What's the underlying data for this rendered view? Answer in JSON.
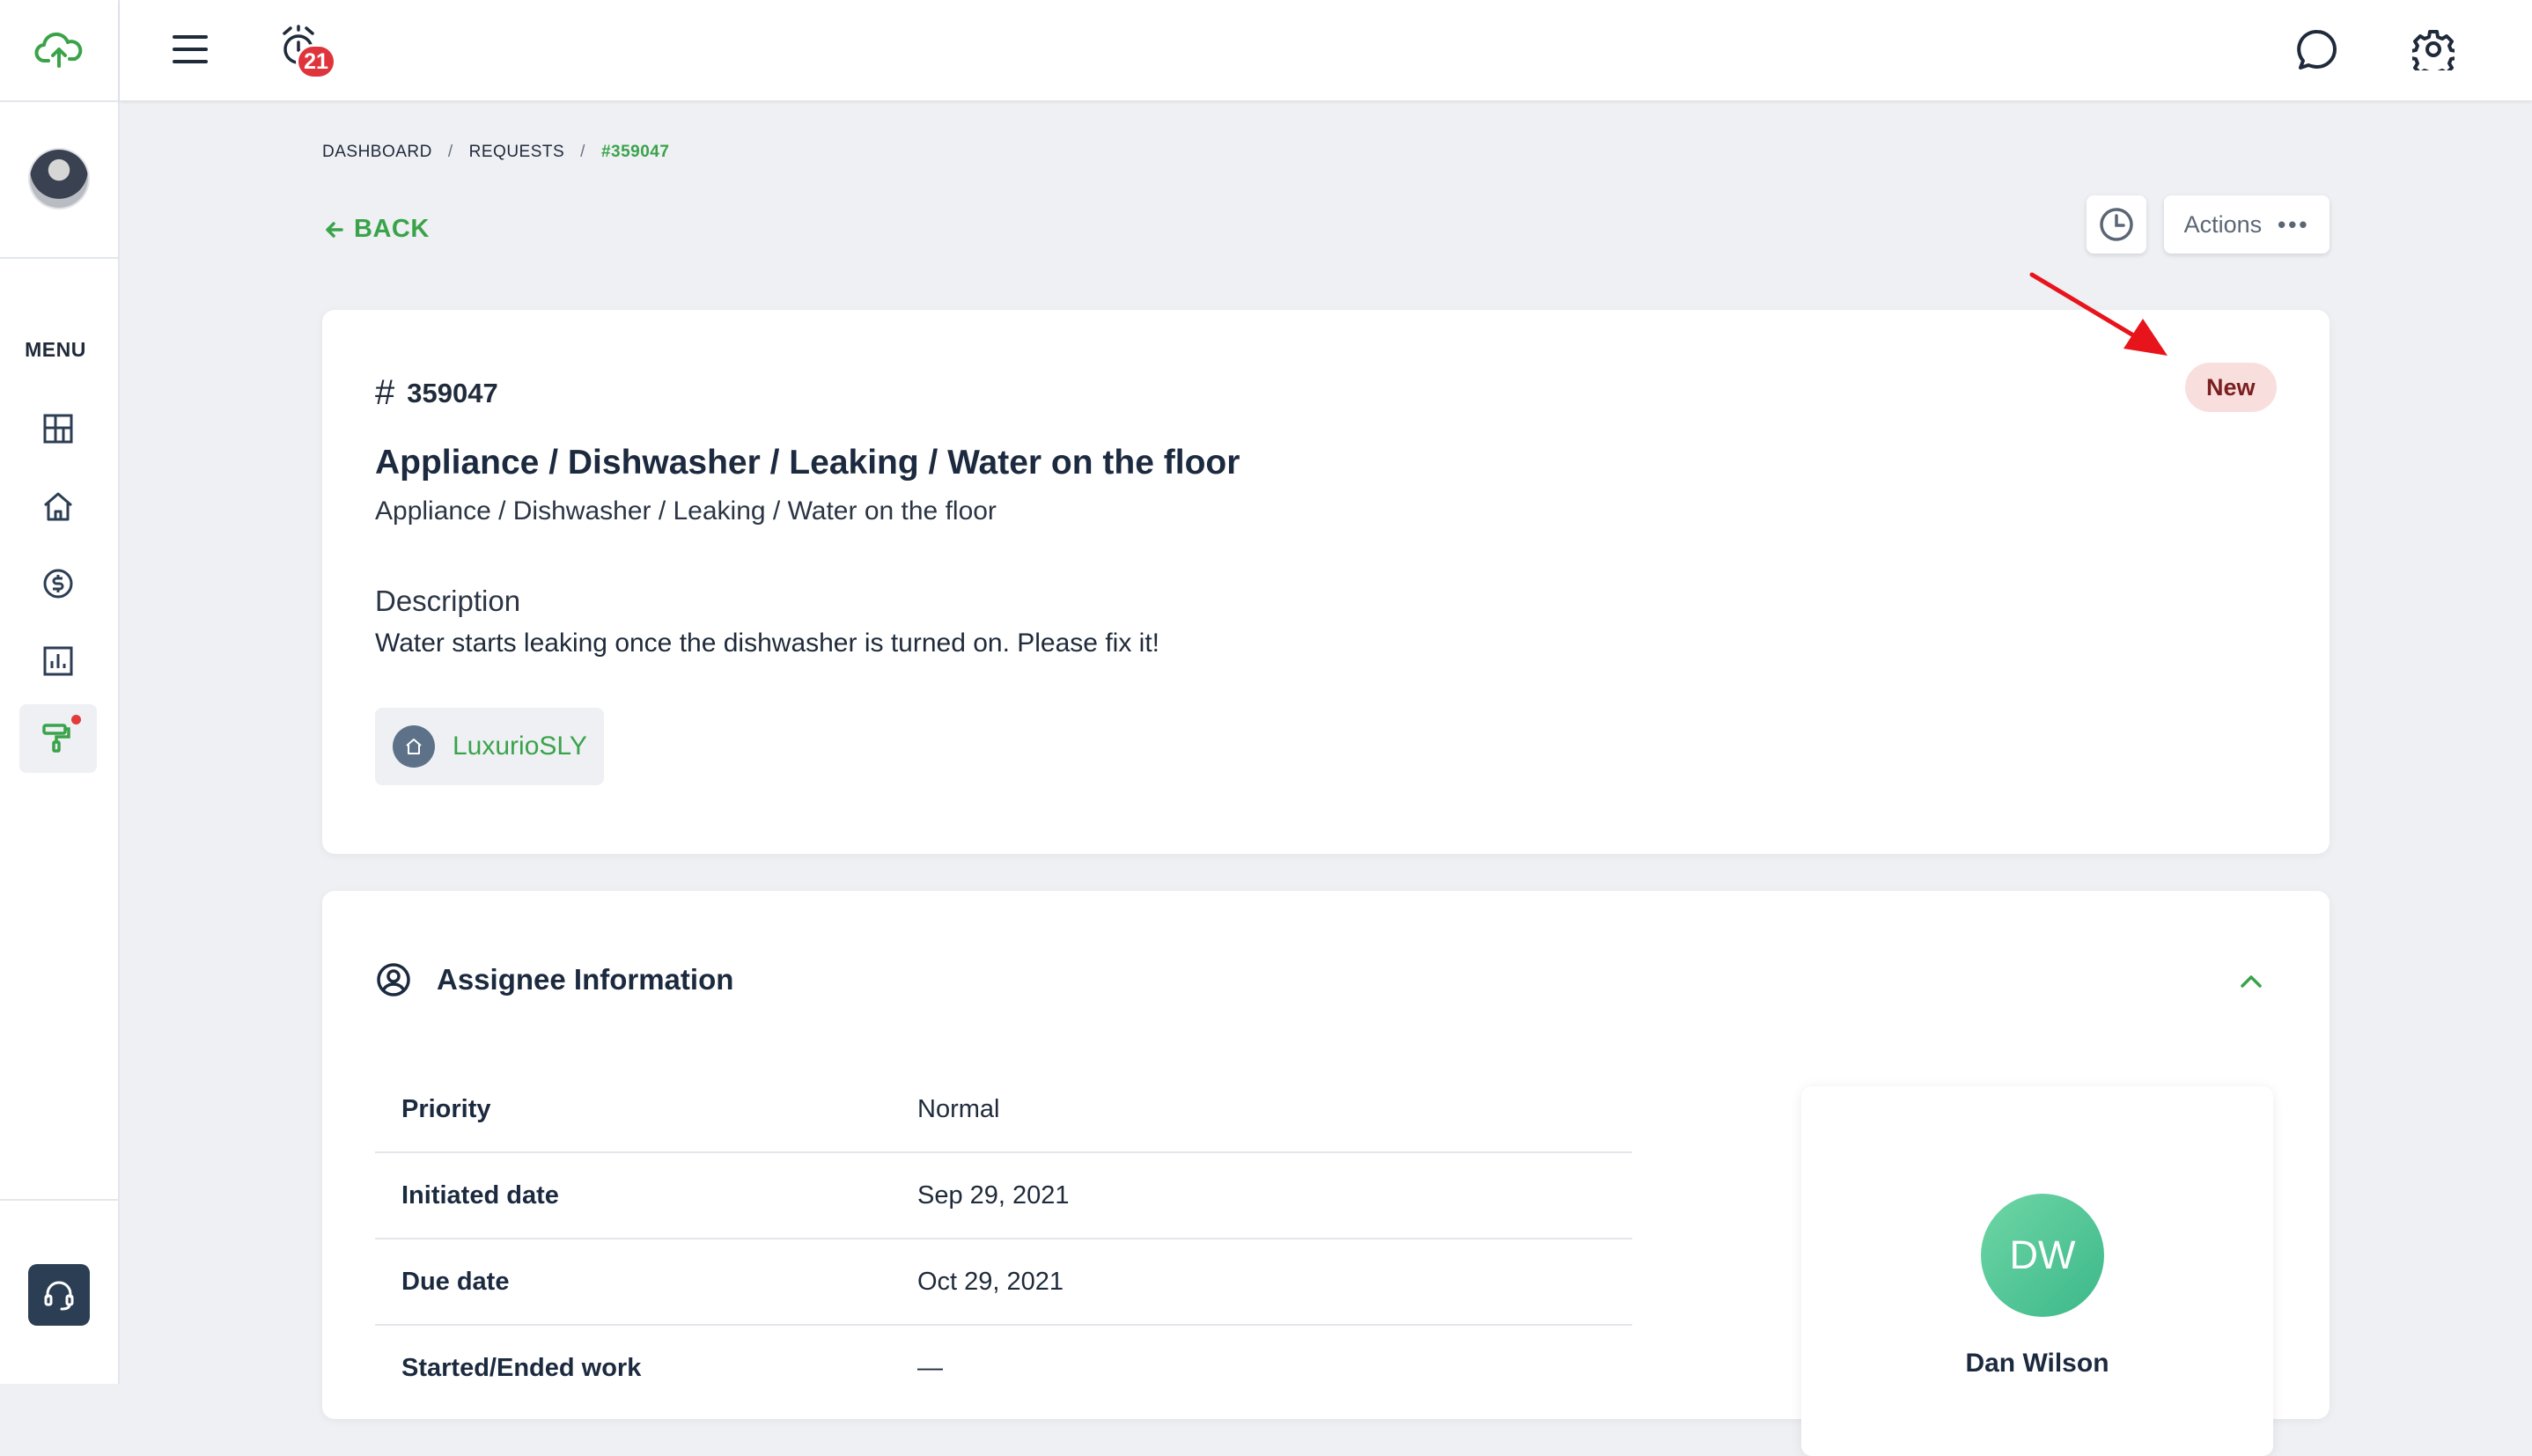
{
  "colors": {
    "accent": "#3aa34a",
    "badge_red": "#e0343c",
    "status_bg": "#f9dede",
    "status_text": "#7a1e1e",
    "avatar_green": "#4cc596",
    "sidebar_dark": "#2c3e53"
  },
  "sidebar": {
    "logo_icon": "cloud-upload-icon",
    "menu_label": "MENU",
    "items": [
      {
        "icon": "dashboard-icon"
      },
      {
        "icon": "home-icon"
      },
      {
        "icon": "dollar-icon"
      },
      {
        "icon": "reports-icon"
      },
      {
        "icon": "maintenance-icon",
        "active": true
      }
    ],
    "support_icon": "headset-icon"
  },
  "topbar": {
    "menu_icon": "hamburger-icon",
    "alarm_icon": "alarm-clock-icon",
    "notification_count": "21",
    "chat_icon": "chat-icon",
    "settings_icon": "gear-icon"
  },
  "breadcrumb": {
    "items": [
      "DASHBOARD",
      "REQUESTS",
      "#359047"
    ],
    "separator": "/"
  },
  "back_label": "BACK",
  "actions_label": "Actions",
  "request": {
    "id": "359047",
    "status": "New",
    "title": "Appliance / Dishwasher / Leaking / Water on the floor",
    "category_path": "Appliance / Dishwasher / Leaking / Water on the floor",
    "description_label": "Description",
    "description": "Water starts leaking once the dishwasher is turned on. Please fix it!",
    "property": "LuxurioSLY"
  },
  "assignee_section": {
    "title": "Assignee Information",
    "rows": [
      {
        "label": "Priority",
        "value": "Normal"
      },
      {
        "label": "Initiated date",
        "value": "Sep 29, 2021"
      },
      {
        "label": "Due date",
        "value": "Oct 29, 2021"
      },
      {
        "label": "Started/Ended work",
        "value": "—"
      }
    ],
    "assignee": {
      "initials": "DW",
      "name": "Dan Wilson"
    }
  }
}
